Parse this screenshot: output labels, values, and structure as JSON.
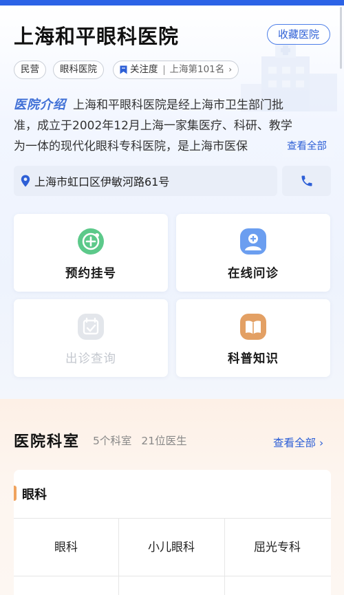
{
  "hospital": {
    "name": "上海和平眼科医院",
    "favorite_label": "收藏医院",
    "tags": [
      "民营",
      "眼科医院"
    ],
    "attention_label": "关注度",
    "attention_rank": "上海第101名",
    "intro_label": "医院介绍",
    "intro_lines": [
      "上海和平眼科医院是经上海市卫生部门批",
      "准，成立于2002年12月上海一家集医疗、科研、教学",
      "为一体的现代化眼科专科医院，是上海市医保"
    ],
    "intro_view_all": "查看全部",
    "address": "上海市虹口区伊敏河路61号"
  },
  "actions": [
    {
      "label": "预约挂号",
      "icon": "plus-circle-icon",
      "enabled": true
    },
    {
      "label": "在线问诊",
      "icon": "doctor-icon",
      "enabled": true
    },
    {
      "label": "出诊查询",
      "icon": "calendar-check-icon",
      "enabled": false
    },
    {
      "label": "科普知识",
      "icon": "book-icon",
      "enabled": true
    }
  ],
  "departments": {
    "title": "医院科室",
    "dept_count": "5个科室",
    "doctor_count": "21位医生",
    "view_all": "查看全部",
    "category": "眼科",
    "items": [
      "眼科",
      "小儿眼科",
      "屈光专科"
    ]
  },
  "colors": {
    "accent": "#2d5fd6",
    "topbar": "#2c63e6",
    "green_icon": "#5cc98a",
    "blue_icon": "#6b9ef0",
    "orange_icon": "#e3a064",
    "dept_accent": "#f0a35e"
  }
}
